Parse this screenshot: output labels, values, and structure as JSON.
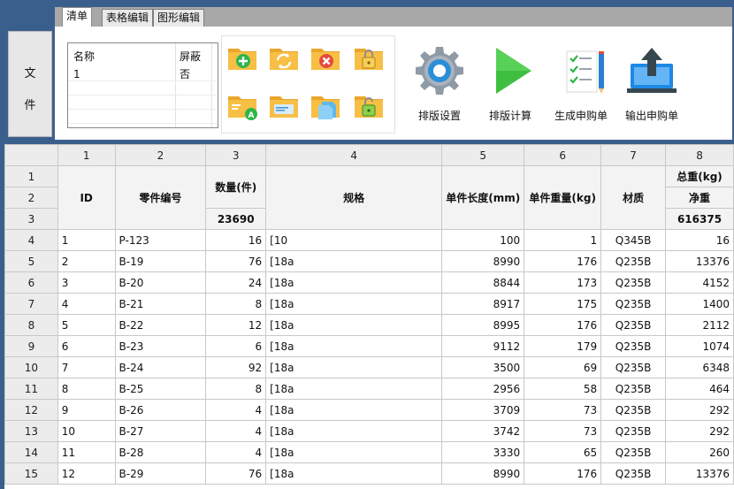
{
  "tabs": [
    "清单",
    "表格编辑",
    "图形编辑"
  ],
  "file_button": {
    "line1": "文",
    "line2": "件"
  },
  "listbox": {
    "headers": [
      "名称",
      "屏蔽"
    ],
    "row": [
      "1",
      "否"
    ]
  },
  "icons": {
    "folder_add": "folder-add-icon",
    "folder_refresh": "folder-refresh-icon",
    "folder_delete": "folder-delete-icon",
    "folder_lock": "folder-lock-icon",
    "folder_account": "folder-user-icon",
    "folder_card": "folder-card-icon",
    "folder_copy": "folder-copy-icon",
    "folder_unlock": "folder-unlock-icon"
  },
  "actions": {
    "layout_settings": "排版设置",
    "layout_compute": "排版计算",
    "generate_po": "生成申购单",
    "export_po": "输出申购单"
  },
  "grid": {
    "col_numbers": [
      "1",
      "2",
      "3",
      "4",
      "5",
      "6",
      "7",
      "8"
    ],
    "row_numbers": [
      "1",
      "2",
      "3",
      "4",
      "5",
      "6",
      "7",
      "8",
      "9",
      "10",
      "11",
      "12",
      "13",
      "14",
      "15"
    ],
    "headers": {
      "id": "ID",
      "part_no": "零件编号",
      "qty": "数量(件)",
      "spec": "规格",
      "unit_length": "单件长度(mm)",
      "unit_weight": "单件重量(kg)",
      "material": "材质",
      "total_weight": "总重(kg)",
      "net": "净重",
      "qty_total": "23690",
      "weight_total": "616375"
    },
    "rows": [
      [
        "1",
        "P-123",
        "16",
        "[10",
        "100",
        "1",
        "Q345B",
        "16"
      ],
      [
        "2",
        "B-19",
        "76",
        "[18a",
        "8990",
        "176",
        "Q235B",
        "13376"
      ],
      [
        "3",
        "B-20",
        "24",
        "[18a",
        "8844",
        "173",
        "Q235B",
        "4152"
      ],
      [
        "4",
        "B-21",
        "8",
        "[18a",
        "8917",
        "175",
        "Q235B",
        "1400"
      ],
      [
        "5",
        "B-22",
        "12",
        "[18a",
        "8995",
        "176",
        "Q235B",
        "2112"
      ],
      [
        "6",
        "B-23",
        "6",
        "[18a",
        "9112",
        "179",
        "Q235B",
        "1074"
      ],
      [
        "7",
        "B-24",
        "92",
        "[18a",
        "3500",
        "69",
        "Q235B",
        "6348"
      ],
      [
        "8",
        "B-25",
        "8",
        "[18a",
        "2956",
        "58",
        "Q235B",
        "464"
      ],
      [
        "9",
        "B-26",
        "4",
        "[18a",
        "3709",
        "73",
        "Q235B",
        "292"
      ],
      [
        "10",
        "B-27",
        "4",
        "[18a",
        "3742",
        "73",
        "Q235B",
        "292"
      ],
      [
        "11",
        "B-28",
        "4",
        "[18a",
        "3330",
        "65",
        "Q235B",
        "260"
      ],
      [
        "12",
        "B-29",
        "76",
        "[18a",
        "8990",
        "176",
        "Q235B",
        "13376"
      ]
    ]
  },
  "colors": {
    "frame": "#3b5f8c",
    "folder": "#f6b73c",
    "play": "#3fbf3f",
    "gear_blue": "#2b8fd8",
    "export_blue": "#1e88e5"
  }
}
